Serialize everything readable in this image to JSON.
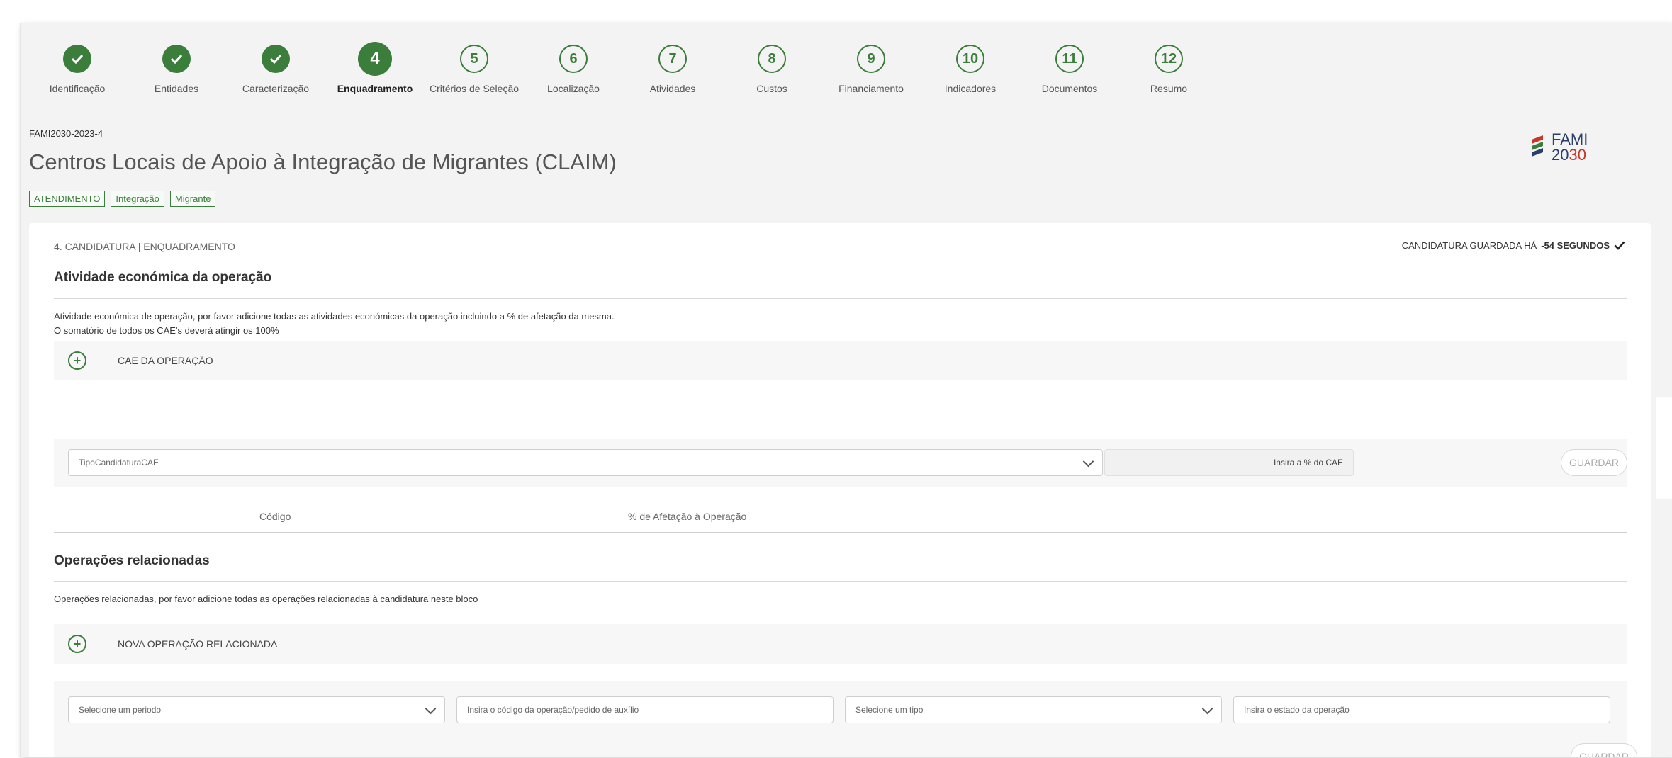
{
  "steps": [
    {
      "n": "1",
      "label": "Identificação",
      "state": "done"
    },
    {
      "n": "2",
      "label": "Entidades",
      "state": "done"
    },
    {
      "n": "3",
      "label": "Caracterização",
      "state": "done"
    },
    {
      "n": "4",
      "label": "Enquadramento",
      "state": "current"
    },
    {
      "n": "5",
      "label": "Critérios de Seleção",
      "state": "todo"
    },
    {
      "n": "6",
      "label": "Localização",
      "state": "todo"
    },
    {
      "n": "7",
      "label": "Atividades",
      "state": "todo"
    },
    {
      "n": "8",
      "label": "Custos",
      "state": "todo"
    },
    {
      "n": "9",
      "label": "Financiamento",
      "state": "todo"
    },
    {
      "n": "10",
      "label": "Indicadores",
      "state": "todo"
    },
    {
      "n": "11",
      "label": "Documentos",
      "state": "todo"
    },
    {
      "n": "12",
      "label": "Resumo",
      "state": "todo"
    }
  ],
  "header": {
    "code": "FAMI2030-2023-4",
    "title": "Centros Locais de Apoio à Integração de Migrantes (CLAIM)",
    "tags": [
      "ATENDIMENTO",
      "Integração",
      "Migrante"
    ],
    "logo_line1": "FAMI",
    "logo_line2a": "20",
    "logo_line2b": "30"
  },
  "card": {
    "breadcrumb": "4. CANDIDATURA | ENQUADRAMENTO",
    "saved_prefix": "CANDIDATURA GUARDADA HÁ",
    "saved_time": "-54 SEGUNDOS"
  },
  "activity": {
    "title": "Atividade económica da operação",
    "desc1": "Atividade económica de operação, por favor adicione todas as atividades económicas da operação incluindo a % de afetação da mesma.",
    "desc2": "O somatório de todos os CAE's deverá atingir os 100%",
    "add_label": "CAE DA OPERAÇÃO",
    "select_placeholder": "TipoCandidaturaCAE",
    "percent_placeholder": "Insira a % do CAE",
    "save_label": "GUARDAR",
    "col_code": "Código",
    "col_percent": "% de Afetação à Operação"
  },
  "related": {
    "title": "Operações relacionadas",
    "desc": "Operações relacionadas, por favor adicione todas as operações relacionadas à candidatura neste bloco",
    "add_label": "NOVA OPERAÇÃO RELACIONADA",
    "period_placeholder": "Selecione um periodo",
    "code_placeholder": "Insira o código da operação/pedido de auxílio",
    "type_placeholder": "Selecione um tipo",
    "state_placeholder": "Insira o estado da operação",
    "save_label": "GUARDAR"
  },
  "colors": {
    "accent": "#3b7d3b",
    "logo_blue": "#2a3f6a",
    "logo_red": "#c8362b"
  }
}
